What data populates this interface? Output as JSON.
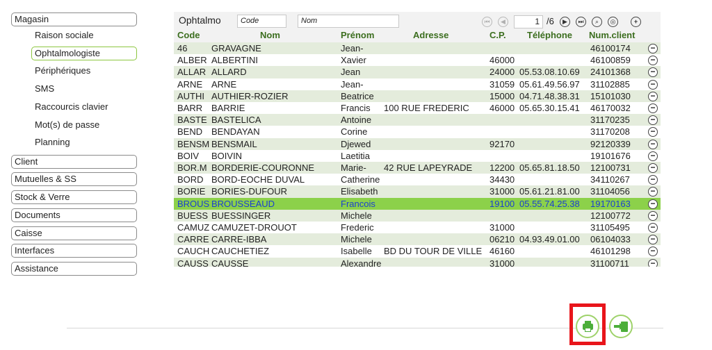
{
  "sidebar": {
    "magasin": "Magasin",
    "sub_items": [
      "Raison sociale",
      "Ophtalmologiste",
      "Périphériques",
      "SMS",
      "Raccourcis clavier",
      "Mot(s) de passe",
      "Planning"
    ],
    "selected_sub": "Ophtalmologiste",
    "sections": [
      "Client",
      "Mutuelles & SS",
      "Stock & Verre",
      "Documents",
      "Caisse",
      "Interfaces",
      "Assistance"
    ]
  },
  "toolbar": {
    "title": "Ophtalmo",
    "code_placeholder": "Code",
    "nom_placeholder": "Nom",
    "page_current": "1",
    "page_total": "/6"
  },
  "table": {
    "headers": [
      "Code",
      "Nom",
      "Prénom",
      "Adresse",
      "C.P.",
      "Téléphone",
      "Num.client"
    ],
    "rows": [
      [
        "46",
        "GRAVAGNE",
        "Jean-",
        "",
        "",
        "",
        "46100174"
      ],
      [
        "ALBER",
        "ALBERTINI",
        "Xavier",
        "",
        "46000",
        "",
        "46100859"
      ],
      [
        "ALLAR",
        "ALLARD",
        "Jean",
        "",
        "24000",
        "05.53.08.10.69",
        "24101368"
      ],
      [
        "ARNE",
        "ARNE",
        "Jean-",
        "",
        "31059",
        "05.61.49.56.97",
        "31102885"
      ],
      [
        "AUTHI",
        "AUTHIER-ROZIER",
        "Beatrice",
        "",
        "15000",
        "04.71.48.38.31",
        "15101030"
      ],
      [
        "BARR",
        "BARRIE",
        "Francis",
        "100 RUE FREDERIC",
        "46000",
        "05.65.30.15.41",
        "46170032"
      ],
      [
        "BASTE",
        "BASTELICA",
        "Antoine",
        "",
        "",
        "",
        "31170235"
      ],
      [
        "BEND",
        "BENDAYAN",
        "Corine",
        "",
        "",
        "",
        "31170208"
      ],
      [
        "BENSM",
        "BENSMAIL",
        "Djewed",
        "",
        "92170",
        "",
        "92120339"
      ],
      [
        "BOIV",
        "BOIVIN",
        "Laetitia",
        "",
        "",
        "",
        "19101676"
      ],
      [
        "BOR.M",
        "BORDERIE-COURONNE",
        "Marie-",
        "42 RUE LAPEYRADE",
        "12200",
        "05.65.81.18.50",
        "12100731"
      ],
      [
        "BORD",
        "BORD-EOCHE DUVAL",
        "Catherine",
        "",
        "34430",
        "",
        "34110267"
      ],
      [
        "BORIE",
        "BORIES-DUFOUR",
        "Elisabeth",
        "",
        "31000",
        "05.61.21.81.00",
        "31104056"
      ],
      [
        "BROUS",
        "BROUSSEAUD",
        "Francois",
        "",
        "19100",
        "05.55.74.25.38",
        "19170163"
      ],
      [
        "BUESS",
        "BUESSINGER",
        "Michele",
        "",
        "",
        "",
        "12100772"
      ],
      [
        "CAMUZ",
        "CAMUZET-DROUOT",
        "Frederic",
        "",
        "31000",
        "",
        "31105495"
      ],
      [
        "CARRE",
        "CARRE-IBBA",
        "Michele",
        "",
        "06210",
        "04.93.49.01.00",
        "06104033"
      ],
      [
        "CAUCH",
        "CAUCHETIEZ",
        "Isabelle",
        "BD DU TOUR DE VILLE",
        "46160",
        "",
        "46101298"
      ],
      [
        "CAUSS",
        "CAUSSE",
        "Alexandre",
        "",
        "31000",
        "",
        "31100711"
      ]
    ],
    "selected_index": 13
  },
  "icons": {
    "first": "first-page-icon",
    "prev": "prev-page-icon",
    "next": "next-page-icon",
    "last": "last-page-icon",
    "search": "search-icon",
    "refresh": "refresh-icon",
    "add": "add-icon",
    "remove": "remove-icon",
    "print": "printer-icon",
    "exit": "exit-icon"
  },
  "colors": {
    "header_text": "#3c6e1f",
    "row_alt": "#e4ecdc",
    "row_selected": "#8cd14a",
    "selected_text": "#1a3fd1",
    "highlight": "#e8151b",
    "accent_green": "#4cae3a"
  }
}
